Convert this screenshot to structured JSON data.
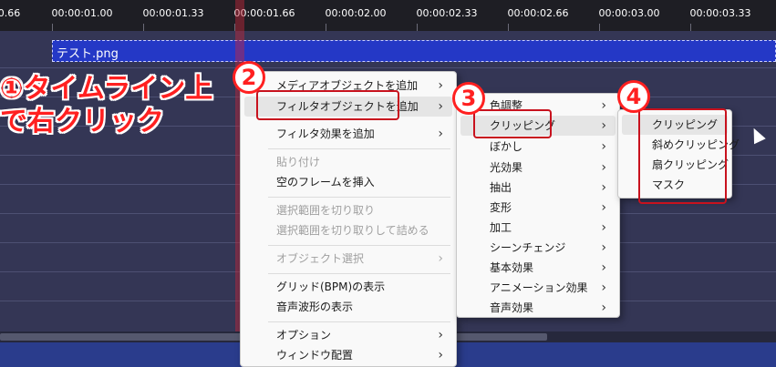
{
  "ruler": {
    "ticks": [
      "0.66",
      "00:00:01.00",
      "00:00:01.33",
      "00:00:01.66",
      "00:00:02.00",
      "00:00:02.33",
      "00:00:02.66",
      "00:00:03.00",
      "00:00:03.33"
    ]
  },
  "clip": {
    "name": "テスト.png"
  },
  "annotations": {
    "step1": "①タイムライン上",
    "step1b": "で右クリック",
    "n2": "2",
    "n3": "3",
    "n4": "4"
  },
  "menu1": {
    "items": [
      {
        "label": "メディアオブジェクトを追加",
        "arrow": "›"
      },
      {
        "label": "フィルタオブジェクトを追加",
        "arrow": "›"
      },
      {
        "label": "フィルタ効果を追加",
        "arrow": "›"
      },
      {
        "label": "貼り付け"
      },
      {
        "label": "空のフレームを挿入"
      },
      {
        "label": "選択範囲を切り取り"
      },
      {
        "label": "選択範囲を切り取りして詰める"
      },
      {
        "label": "オブジェクト選択",
        "arrow": "›"
      },
      {
        "label": "グリッド(BPM)の表示"
      },
      {
        "label": "音声波形の表示"
      },
      {
        "label": "オプション",
        "arrow": "›"
      },
      {
        "label": "ウィンドウ配置",
        "arrow": "›"
      }
    ]
  },
  "menu2": {
    "items": [
      {
        "label": "色調整",
        "arrow": "›"
      },
      {
        "label": "クリッピング",
        "arrow": "›"
      },
      {
        "label": "ぼかし",
        "arrow": "›"
      },
      {
        "label": "光効果",
        "arrow": "›"
      },
      {
        "label": "抽出",
        "arrow": "›"
      },
      {
        "label": "変形",
        "arrow": "›"
      },
      {
        "label": "加工",
        "arrow": "›"
      },
      {
        "label": "シーンチェンジ",
        "arrow": "›"
      },
      {
        "label": "基本効果",
        "arrow": "›"
      },
      {
        "label": "アニメーション効果",
        "arrow": "›"
      },
      {
        "label": "音声効果",
        "arrow": "›"
      }
    ]
  },
  "menu3": {
    "items": [
      {
        "label": "クリッピング"
      },
      {
        "label": "斜めクリッピング"
      },
      {
        "label": "扇クリッピング"
      },
      {
        "label": "マスク"
      }
    ]
  },
  "colors": {
    "accent": "#ff2020",
    "clip": "#2438c6",
    "playhead": "#c8283c"
  }
}
